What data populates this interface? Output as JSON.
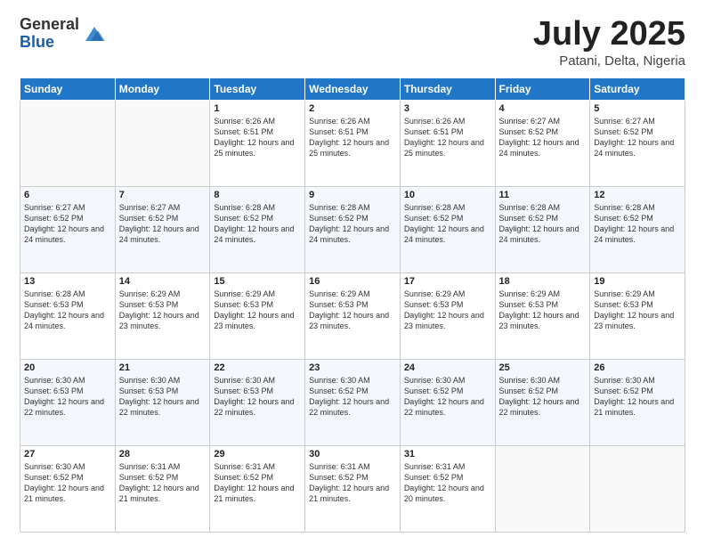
{
  "header": {
    "logo_general": "General",
    "logo_blue": "Blue",
    "month": "July 2025",
    "location": "Patani, Delta, Nigeria"
  },
  "weekdays": [
    "Sunday",
    "Monday",
    "Tuesday",
    "Wednesday",
    "Thursday",
    "Friday",
    "Saturday"
  ],
  "weeks": [
    [
      {
        "day": "",
        "sunrise": "",
        "sunset": "",
        "daylight": ""
      },
      {
        "day": "",
        "sunrise": "",
        "sunset": "",
        "daylight": ""
      },
      {
        "day": "1",
        "sunrise": "Sunrise: 6:26 AM",
        "sunset": "Sunset: 6:51 PM",
        "daylight": "Daylight: 12 hours and 25 minutes."
      },
      {
        "day": "2",
        "sunrise": "Sunrise: 6:26 AM",
        "sunset": "Sunset: 6:51 PM",
        "daylight": "Daylight: 12 hours and 25 minutes."
      },
      {
        "day": "3",
        "sunrise": "Sunrise: 6:26 AM",
        "sunset": "Sunset: 6:51 PM",
        "daylight": "Daylight: 12 hours and 25 minutes."
      },
      {
        "day": "4",
        "sunrise": "Sunrise: 6:27 AM",
        "sunset": "Sunset: 6:52 PM",
        "daylight": "Daylight: 12 hours and 24 minutes."
      },
      {
        "day": "5",
        "sunrise": "Sunrise: 6:27 AM",
        "sunset": "Sunset: 6:52 PM",
        "daylight": "Daylight: 12 hours and 24 minutes."
      }
    ],
    [
      {
        "day": "6",
        "sunrise": "Sunrise: 6:27 AM",
        "sunset": "Sunset: 6:52 PM",
        "daylight": "Daylight: 12 hours and 24 minutes."
      },
      {
        "day": "7",
        "sunrise": "Sunrise: 6:27 AM",
        "sunset": "Sunset: 6:52 PM",
        "daylight": "Daylight: 12 hours and 24 minutes."
      },
      {
        "day": "8",
        "sunrise": "Sunrise: 6:28 AM",
        "sunset": "Sunset: 6:52 PM",
        "daylight": "Daylight: 12 hours and 24 minutes."
      },
      {
        "day": "9",
        "sunrise": "Sunrise: 6:28 AM",
        "sunset": "Sunset: 6:52 PM",
        "daylight": "Daylight: 12 hours and 24 minutes."
      },
      {
        "day": "10",
        "sunrise": "Sunrise: 6:28 AM",
        "sunset": "Sunset: 6:52 PM",
        "daylight": "Daylight: 12 hours and 24 minutes."
      },
      {
        "day": "11",
        "sunrise": "Sunrise: 6:28 AM",
        "sunset": "Sunset: 6:52 PM",
        "daylight": "Daylight: 12 hours and 24 minutes."
      },
      {
        "day": "12",
        "sunrise": "Sunrise: 6:28 AM",
        "sunset": "Sunset: 6:52 PM",
        "daylight": "Daylight: 12 hours and 24 minutes."
      }
    ],
    [
      {
        "day": "13",
        "sunrise": "Sunrise: 6:28 AM",
        "sunset": "Sunset: 6:53 PM",
        "daylight": "Daylight: 12 hours and 24 minutes."
      },
      {
        "day": "14",
        "sunrise": "Sunrise: 6:29 AM",
        "sunset": "Sunset: 6:53 PM",
        "daylight": "Daylight: 12 hours and 23 minutes."
      },
      {
        "day": "15",
        "sunrise": "Sunrise: 6:29 AM",
        "sunset": "Sunset: 6:53 PM",
        "daylight": "Daylight: 12 hours and 23 minutes."
      },
      {
        "day": "16",
        "sunrise": "Sunrise: 6:29 AM",
        "sunset": "Sunset: 6:53 PM",
        "daylight": "Daylight: 12 hours and 23 minutes."
      },
      {
        "day": "17",
        "sunrise": "Sunrise: 6:29 AM",
        "sunset": "Sunset: 6:53 PM",
        "daylight": "Daylight: 12 hours and 23 minutes."
      },
      {
        "day": "18",
        "sunrise": "Sunrise: 6:29 AM",
        "sunset": "Sunset: 6:53 PM",
        "daylight": "Daylight: 12 hours and 23 minutes."
      },
      {
        "day": "19",
        "sunrise": "Sunrise: 6:29 AM",
        "sunset": "Sunset: 6:53 PM",
        "daylight": "Daylight: 12 hours and 23 minutes."
      }
    ],
    [
      {
        "day": "20",
        "sunrise": "Sunrise: 6:30 AM",
        "sunset": "Sunset: 6:53 PM",
        "daylight": "Daylight: 12 hours and 22 minutes."
      },
      {
        "day": "21",
        "sunrise": "Sunrise: 6:30 AM",
        "sunset": "Sunset: 6:53 PM",
        "daylight": "Daylight: 12 hours and 22 minutes."
      },
      {
        "day": "22",
        "sunrise": "Sunrise: 6:30 AM",
        "sunset": "Sunset: 6:53 PM",
        "daylight": "Daylight: 12 hours and 22 minutes."
      },
      {
        "day": "23",
        "sunrise": "Sunrise: 6:30 AM",
        "sunset": "Sunset: 6:52 PM",
        "daylight": "Daylight: 12 hours and 22 minutes."
      },
      {
        "day": "24",
        "sunrise": "Sunrise: 6:30 AM",
        "sunset": "Sunset: 6:52 PM",
        "daylight": "Daylight: 12 hours and 22 minutes."
      },
      {
        "day": "25",
        "sunrise": "Sunrise: 6:30 AM",
        "sunset": "Sunset: 6:52 PM",
        "daylight": "Daylight: 12 hours and 22 minutes."
      },
      {
        "day": "26",
        "sunrise": "Sunrise: 6:30 AM",
        "sunset": "Sunset: 6:52 PM",
        "daylight": "Daylight: 12 hours and 21 minutes."
      }
    ],
    [
      {
        "day": "27",
        "sunrise": "Sunrise: 6:30 AM",
        "sunset": "Sunset: 6:52 PM",
        "daylight": "Daylight: 12 hours and 21 minutes."
      },
      {
        "day": "28",
        "sunrise": "Sunrise: 6:31 AM",
        "sunset": "Sunset: 6:52 PM",
        "daylight": "Daylight: 12 hours and 21 minutes."
      },
      {
        "day": "29",
        "sunrise": "Sunrise: 6:31 AM",
        "sunset": "Sunset: 6:52 PM",
        "daylight": "Daylight: 12 hours and 21 minutes."
      },
      {
        "day": "30",
        "sunrise": "Sunrise: 6:31 AM",
        "sunset": "Sunset: 6:52 PM",
        "daylight": "Daylight: 12 hours and 21 minutes."
      },
      {
        "day": "31",
        "sunrise": "Sunrise: 6:31 AM",
        "sunset": "Sunset: 6:52 PM",
        "daylight": "Daylight: 12 hours and 20 minutes."
      },
      {
        "day": "",
        "sunrise": "",
        "sunset": "",
        "daylight": ""
      },
      {
        "day": "",
        "sunrise": "",
        "sunset": "",
        "daylight": ""
      }
    ]
  ]
}
